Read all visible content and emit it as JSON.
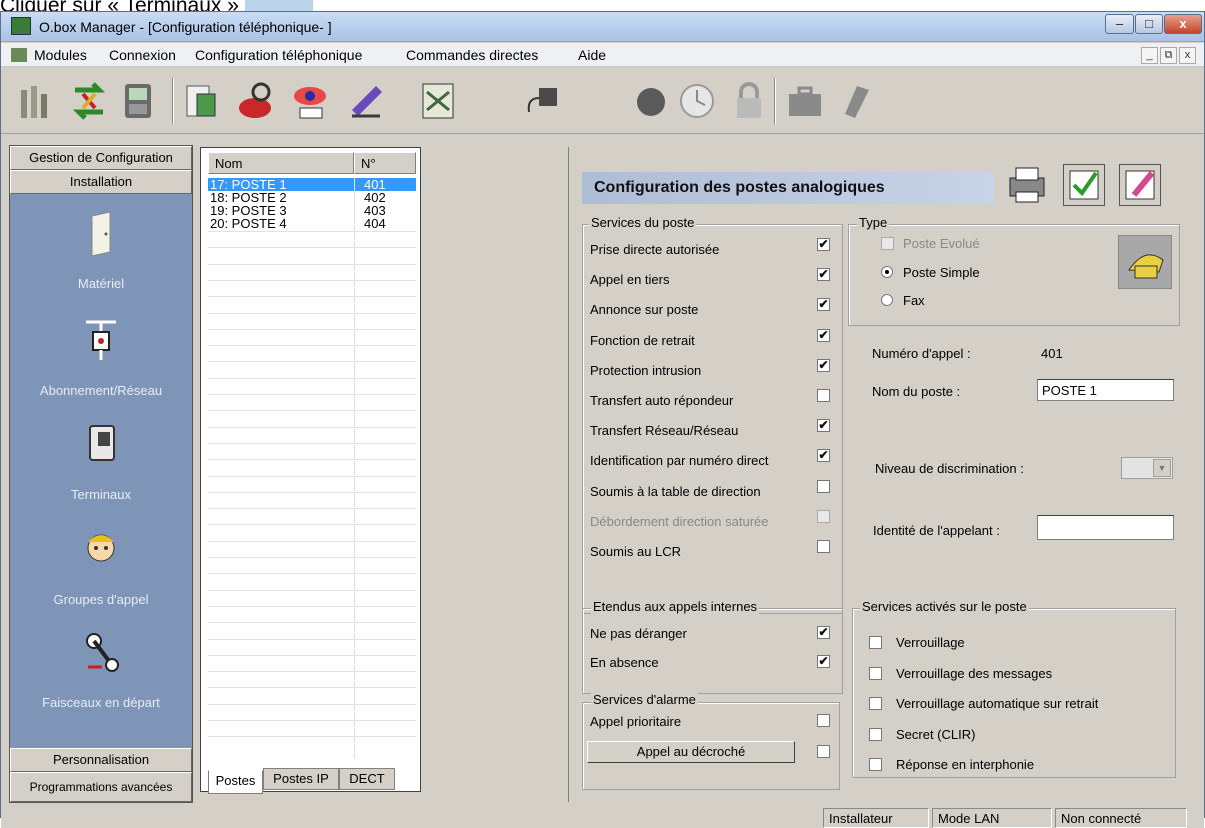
{
  "caption": "Cliquer sur « Terminaux »",
  "window": {
    "title": "O.box Manager - [Configuration téléphonique- ]",
    "minimize": "–",
    "maximize": "□",
    "close": "x"
  },
  "menu": {
    "items": [
      "Modules",
      "Connexion",
      "Configuration téléphonique",
      "Commandes directes",
      "Aide"
    ],
    "mdi_min": "_",
    "mdi_restore": "⧉",
    "mdi_close": "x"
  },
  "toolbar": {
    "icons": [
      "modules-icon",
      "connexion-icon",
      "terminal-icon",
      "config-icon",
      "phone-search-icon",
      "eye-icon",
      "edit-icon",
      "network-icon",
      "plug-icon",
      "bomb-icon",
      "clock-icon",
      "lock-icon",
      "briefcase-icon",
      "mobile-icon"
    ]
  },
  "sidebar": {
    "header_top": "Gestion de Configuration",
    "header_section": "Installation",
    "items": [
      {
        "label": "Matériel",
        "icon": "door-icon"
      },
      {
        "label": "Abonnement/Réseau",
        "icon": "network-plug-icon"
      },
      {
        "label": "Terminaux",
        "icon": "terminal-phone-icon"
      },
      {
        "label": "Groupes d'appel",
        "icon": "person-icon"
      },
      {
        "label": "Faisceaux en départ",
        "icon": "cable-icon"
      }
    ],
    "footer1": "Personnalisation",
    "footer2": "Programmations avancées"
  },
  "list": {
    "col_name": "Nom",
    "col_num": "N°",
    "rows": [
      {
        "name": "17: POSTE 1",
        "num": "401"
      },
      {
        "name": "18: POSTE 2",
        "num": "402"
      },
      {
        "name": "19: POSTE 3",
        "num": "403"
      },
      {
        "name": "20: POSTE 4",
        "num": "404"
      }
    ],
    "tabs": [
      "Postes",
      "Postes IP",
      "DECT"
    ]
  },
  "main": {
    "title": "Configuration des postes analogiques",
    "services_title": "Services du poste",
    "services": [
      {
        "label": "Prise directe autorisée",
        "checked": true,
        "disabled": false
      },
      {
        "label": "Appel en tiers",
        "checked": true,
        "disabled": false
      },
      {
        "label": "Annonce sur poste",
        "checked": true,
        "disabled": false
      },
      {
        "label": "Fonction de retrait",
        "checked": true,
        "disabled": false
      },
      {
        "label": "Protection intrusion",
        "checked": true,
        "disabled": false
      },
      {
        "label": "Transfert auto répondeur",
        "checked": false,
        "disabled": false
      },
      {
        "label": "Transfert Réseau/Réseau",
        "checked": true,
        "disabled": false
      },
      {
        "label": "Identification par numéro direct",
        "checked": true,
        "disabled": false
      },
      {
        "label": "Soumis à la table de direction",
        "checked": false,
        "disabled": false
      },
      {
        "label": "Débordement direction saturée",
        "checked": false,
        "disabled": true
      },
      {
        "label": "Soumis au LCR",
        "checked": false,
        "disabled": false
      }
    ],
    "internal_title": "Etendus aux appels internes",
    "internal": [
      {
        "label": "Ne pas déranger",
        "checked": true
      },
      {
        "label": "En absence",
        "checked": true
      }
    ],
    "alarm_title": "Services d'alarme",
    "alarm_priority": "Appel prioritaire",
    "alarm_button": "Appel au décroché",
    "type_title": "Type",
    "type_options": [
      "Poste Evolué",
      "Poste Simple",
      "Fax"
    ],
    "numero_label": "Numéro d'appel :",
    "numero_value": "401",
    "nom_label": "Nom du poste :",
    "nom_value": "POSTE 1",
    "discrim_label": "Niveau de discrimination :",
    "identite_label": "Identité de l'appelant :",
    "activated_title": "Services activés sur le poste",
    "activated": [
      "Verrouillage",
      "Verrouillage des messages",
      "Verrouillage automatique sur retrait",
      "Secret  (CLIR)",
      "Réponse en interphonie"
    ]
  },
  "status": {
    "user": "Installateur",
    "mode": "Mode LAN",
    "conn": "Non connecté"
  },
  "colors": {
    "sidebar_bg": "#7e95b8",
    "selection": "#3399ff",
    "header_bar": "#aebdd6"
  }
}
